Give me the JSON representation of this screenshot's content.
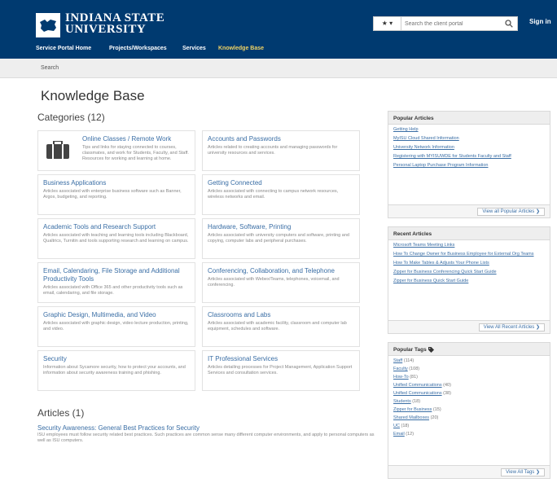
{
  "colors": {
    "header_bg": "#003a70",
    "nav_active": "#f0d264",
    "link": "#3a6ea5"
  },
  "header": {
    "logo_line1": "INDIANA STATE",
    "logo_line2": "UNIVERSITY",
    "logo_icon": "indiana-state-map-icon",
    "search_scope": "★ ▾",
    "search_placeholder": "Search the client portal",
    "search_icon": "search-icon",
    "sign_in": "Sign in"
  },
  "nav": {
    "items": [
      {
        "label": "Service Portal Home"
      },
      {
        "label": "Projects/Workspaces"
      },
      {
        "label": "Services"
      },
      {
        "label": "Knowledge Base"
      }
    ]
  },
  "breadcrumb": {
    "label": "Search"
  },
  "page": {
    "title": "Knowledge Base",
    "categories_heading": "Categories (12)",
    "articles_heading": "Articles (1)"
  },
  "categories": [
    {
      "title": "Online Classes / Remote Work",
      "desc": "Tips and links for staying connected to courses, classmates, and work for Students, Faculty, and Staff. Resources for working and learning at home.",
      "icon": "briefcase-icon"
    },
    {
      "title": "Accounts and Passwords",
      "desc": "Articles related to creating accounts and managing passwords for university resources and services."
    },
    {
      "title": "Business Applications",
      "desc": "Articles associated with enterprise business software such as Banner, Argos, budgeting, and reporting."
    },
    {
      "title": "Getting Connected",
      "desc": "Articles associated with connecting to campus network resources, wireless networks and email."
    },
    {
      "title": "Academic Tools and Research Support",
      "desc": "Articles associated with teaching and learning tools including Blackboard, Qualtrics, Turnitin and tools supporting research and learning on campus."
    },
    {
      "title": "Hardware, Software, Printing",
      "desc": "Articles associated with university computers and software, printing and copying, computer labs and peripheral purchases."
    },
    {
      "title": "Email, Calendaring, File Storage and Additional Productivity Tools",
      "desc": "Articles associated with Office 365 and other productivity tools such as email, calendaring, and file storage."
    },
    {
      "title": "Conferencing, Collaboration, and Telephone",
      "desc": "Articles associated with Webex/Teams, telephones, voicemail, and conferencing."
    },
    {
      "title": "Graphic Design, Multimedia, and Video",
      "desc": "Articles associated with graphic design, video lecture production, printing, and video."
    },
    {
      "title": "Classrooms and Labs",
      "desc": "Articles associated with academic facility, classroom and computer lab equipment, schedules and software."
    },
    {
      "title": "Security",
      "desc": "Information about Sycamore security, how to protect your accounts, and information about security awareness training and phishing."
    },
    {
      "title": "IT Professional Services",
      "desc": "Articles detailing processes for Project Management, Application Support Services and consultation services."
    }
  ],
  "articles": [
    {
      "title": "Security Awareness: General Best Practices for Security",
      "desc": "ISU employees must follow security related best practices. Such practices are common sense many different computer environments, and apply to personal computers as well as ISU computers."
    }
  ],
  "popular_articles": {
    "heading": "Popular Articles",
    "items": [
      "Getting Help",
      "MyISU Cloud Shared Information",
      "University Network Information",
      "Registering with MYISUWDE for Students Faculty and Staff",
      "Personal Laptop Purchase Program Information"
    ],
    "button": "View all Popular Articles ❯"
  },
  "recent_articles": {
    "heading": "Recent Articles",
    "items": [
      "Microsoft Teams Meeting Links",
      "How To Change Owner for Business Employee for External Org Teams",
      "How To Make Tables & Adjusts Your Phone Lists",
      "Zipper for Business Conferencing Quick Start Guide",
      "Zipper for Business Quick Start Guide"
    ],
    "button": "View All Recent Articles ❯"
  },
  "popular_tags": {
    "heading": "Popular Tags",
    "heading_icon": "tag-icon",
    "items": [
      {
        "name": "Staff",
        "count": "(114)"
      },
      {
        "name": "Faculty",
        "count": "(108)"
      },
      {
        "name": "How-To",
        "count": "(81)"
      },
      {
        "name": "Unified Communications",
        "count": "(40)"
      },
      {
        "name": "Unified Communications",
        "count": "(38)"
      },
      {
        "name": "Students",
        "count": "(18)"
      },
      {
        "name": "Zipper for Business",
        "count": "(15)"
      },
      {
        "name": "Shared Mailboxes",
        "count": "(20)"
      },
      {
        "name": "UC",
        "count": "(18)"
      },
      {
        "name": "Email",
        "count": "(12)"
      }
    ],
    "button": "View All Tags ❯"
  }
}
